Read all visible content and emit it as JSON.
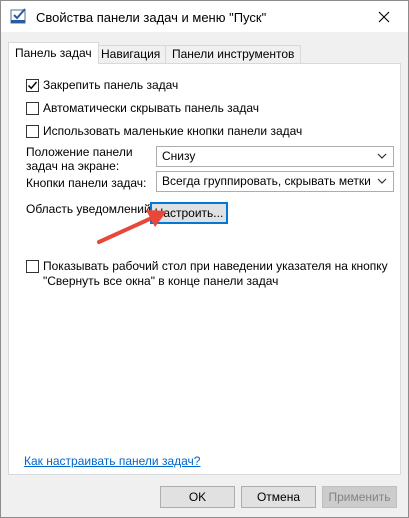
{
  "window": {
    "title": "Свойства панели задач и меню \"Пуск\""
  },
  "tabs": [
    {
      "label": "Панель задач",
      "active": true
    },
    {
      "label": "Навигация",
      "active": false
    },
    {
      "label": "Панели инструментов",
      "active": false
    }
  ],
  "options": {
    "lock_taskbar": {
      "label": "Закрепить панель задач",
      "checked": true
    },
    "auto_hide": {
      "label": "Автоматически скрывать панель задач",
      "checked": false
    },
    "small_buttons": {
      "label": "Использовать маленькие кнопки панели задач",
      "checked": false
    }
  },
  "position": {
    "label_line1": "Положение панели",
    "label_line2": "задач на экране:",
    "value": "Снизу"
  },
  "buttons_setting": {
    "label": "Кнопки панели задач:",
    "value": "Всегда группировать, скрывать метки"
  },
  "notification": {
    "label": "Область уведомлений:",
    "button_label": "Настроить..."
  },
  "peek": {
    "label_line1": "Показывать рабочий стол при наведении указателя на кнопку",
    "label_line2": "\"Свернуть все окна\" в конце панели задач",
    "checked": false
  },
  "help_link": "Как настраивать панели задач?",
  "footer": {
    "ok_label": "OK",
    "cancel_label": "Отмена",
    "apply_label": "Применить"
  },
  "colors": {
    "accent": "#0078d7",
    "arrow": "#e8473a",
    "link": "#0066cc"
  }
}
